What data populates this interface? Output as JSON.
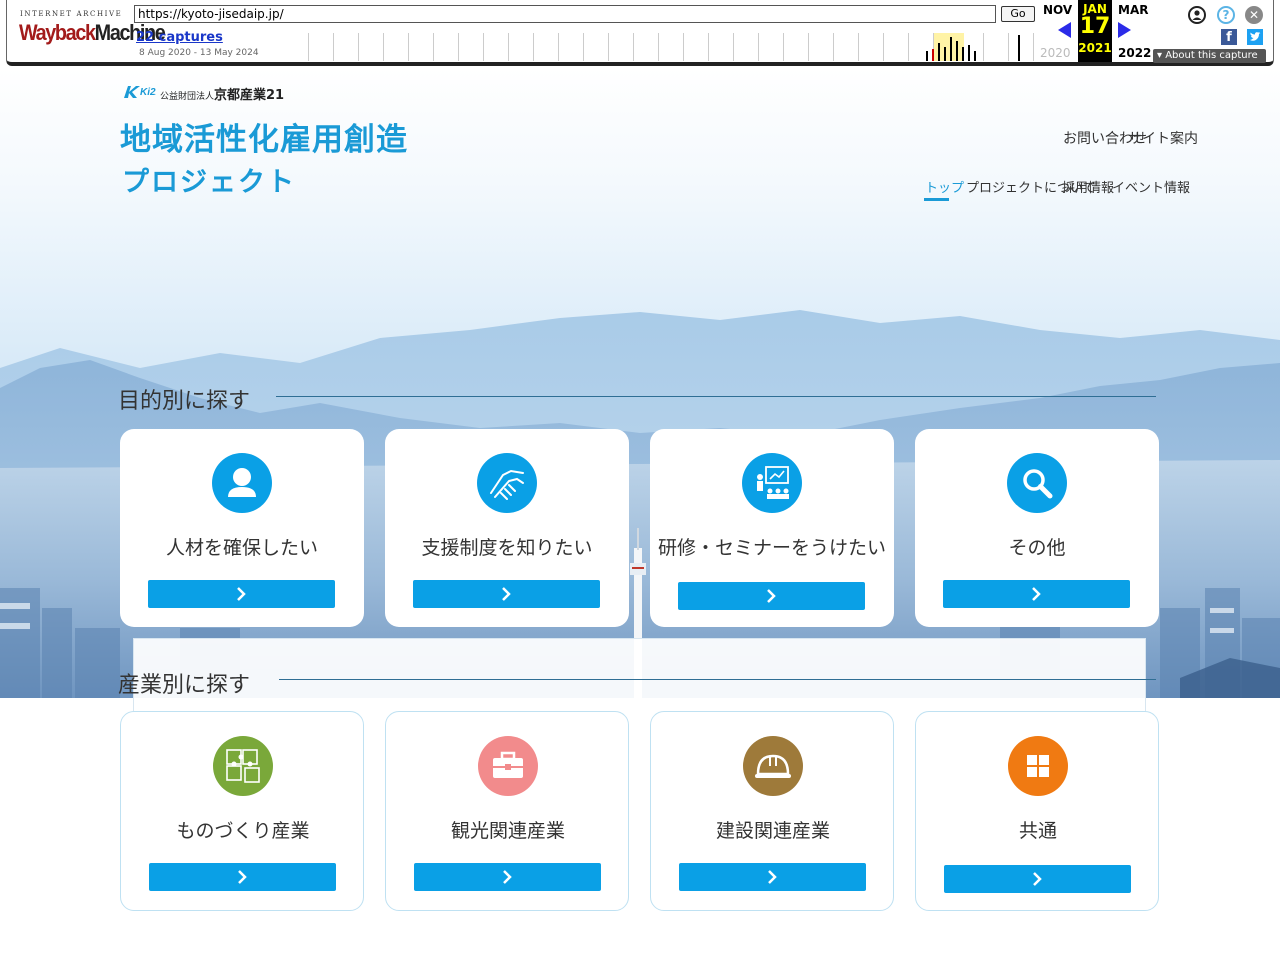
{
  "wayback": {
    "logo_top": "INTERNET ARCHIVE",
    "logo_main_a": "Wayback",
    "logo_main_b": "Machine",
    "url": "https://kyoto-jisedaip.jp/",
    "go_label": "Go",
    "captures": "22 captures",
    "date_range": "8 Aug 2020 - 13 May 2024",
    "prev_month": "NOV",
    "cur_month": "JAN",
    "next_month": "MAR",
    "cur_day": "17",
    "prev_year": "2020",
    "cur_year": "2021",
    "next_year": "2022",
    "about": "About this capture",
    "colors": {
      "arrow": "#2b2be8",
      "highlight": "#ffff00",
      "logo_red": "#a31b1b"
    }
  },
  "header": {
    "org_logo_mark": "Ki21",
    "org_prefix": "公益財団法人",
    "org_name": "京都産業21",
    "title_line1": "地域活性化雇用創造",
    "title_line2": "プロジェクト",
    "util_links": [
      "お問い合わせ",
      "サイト案内"
    ],
    "nav": [
      "トップ",
      "プロジェクトについて",
      "採用情報",
      "イベント情報"
    ],
    "active_nav": 0
  },
  "purpose": {
    "heading": "目的別に探す",
    "cards": [
      {
        "label": "人材を確保したい",
        "icon": "person-icon",
        "color": "#0aa0e6"
      },
      {
        "label": "支援制度を知りたい",
        "icon": "handshake-icon",
        "color": "#0aa0e6"
      },
      {
        "label": "研修・セミナーをうけたい",
        "icon": "seminar-icon",
        "color": "#0aa0e6"
      },
      {
        "label": "その他",
        "icon": "search-icon",
        "color": "#0aa0e6"
      }
    ]
  },
  "industry": {
    "heading": "産業別に探す",
    "cards": [
      {
        "label": "ものづくり産業",
        "icon": "puzzle-icon",
        "color": "#7aa83a"
      },
      {
        "label": "観光関連産業",
        "icon": "suitcase-icon",
        "color": "#f28b8c"
      },
      {
        "label": "建設関連産業",
        "icon": "helmet-icon",
        "color": "#9e7a3a"
      },
      {
        "label": "共通",
        "icon": "grid-icon",
        "color": "#f07a12"
      }
    ]
  },
  "accent_color": "#1a9ad6",
  "button_color": "#0aa0e6"
}
